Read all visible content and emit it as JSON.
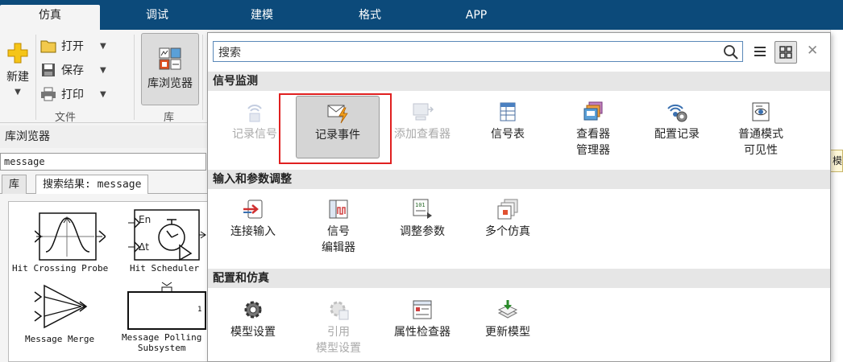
{
  "top_tabs": [
    "仿真",
    "调试",
    "建模",
    "格式",
    "APP"
  ],
  "ribbon": {
    "new_label": "新建",
    "open_label": "打开",
    "save_label": "保存",
    "print_label": "打印",
    "file_section": "文件",
    "library_browser_label": "库浏览器",
    "library_section": "库"
  },
  "library_panel": {
    "title": "库浏览器",
    "search_value": "message",
    "tabs": [
      "库",
      "搜索结果: message"
    ],
    "blocks": [
      "Hit Crossing Probe",
      "Hit Scheduler",
      "Message Merge",
      "Message Polling\nSubsystem"
    ],
    "scheduler_labels": {
      "en": "En",
      "dt": "Δt"
    }
  },
  "canvas": {
    "tab_fragment": "模"
  },
  "gallery": {
    "search_placeholder": "搜索",
    "categories": [
      {
        "title": "信号监测",
        "items": [
          {
            "label": "记录信号",
            "disabled": true,
            "icon": "log-signal-icon"
          },
          {
            "label": "记录事件",
            "selected": true,
            "icon": "log-event-icon"
          },
          {
            "label": "添加查看器",
            "disabled": true,
            "icon": "add-viewer-icon"
          },
          {
            "label": "信号表",
            "icon": "signal-table-icon"
          },
          {
            "label": "查看器\n管理器",
            "icon": "viewer-manager-icon"
          },
          {
            "label": "配置记录",
            "icon": "configure-logging-icon"
          },
          {
            "label": "普通模式\n可见性",
            "icon": "normal-mode-visibility-icon"
          }
        ]
      },
      {
        "title": "输入和参数调整",
        "items": [
          {
            "label": "连接输入",
            "icon": "connect-inputs-icon"
          },
          {
            "label": "信号\n编辑器",
            "icon": "signal-editor-icon"
          },
          {
            "label": "调整参数",
            "icon": "tune-parameters-icon"
          },
          {
            "label": "多个仿真",
            "icon": "multiple-simulations-icon"
          }
        ]
      },
      {
        "title": "配置和仿真",
        "items": [
          {
            "label": "模型设置",
            "icon": "model-settings-icon"
          },
          {
            "label": "引用\n模型设置",
            "disabled": true,
            "icon": "referenced-model-settings-icon"
          },
          {
            "label": "属性检查器",
            "icon": "property-inspector-icon"
          },
          {
            "label": "更新模型",
            "icon": "update-model-icon"
          }
        ]
      }
    ]
  },
  "colors": {
    "tabbar": "#0c4a7a",
    "highlight": "#e02020",
    "category_bg": "#e6e6e6"
  }
}
